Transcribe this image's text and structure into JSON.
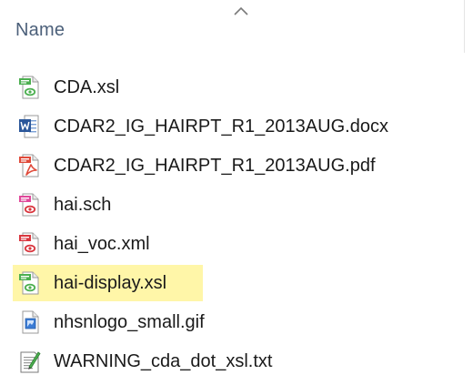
{
  "header": {
    "column_name": "Name",
    "sort_indicator_icon": "chevron-up-icon"
  },
  "files": [
    {
      "name": "CDA.xsl",
      "icon": "xsl-file-icon",
      "selected": false
    },
    {
      "name": "CDAR2_IG_HAIRPT_R1_2013AUG.docx",
      "icon": "word-document-icon",
      "selected": false
    },
    {
      "name": "CDAR2_IG_HAIRPT_R1_2013AUG.pdf",
      "icon": "pdf-file-icon",
      "selected": false
    },
    {
      "name": "hai.sch",
      "icon": "sch-file-icon",
      "selected": false
    },
    {
      "name": "hai_voc.xml",
      "icon": "xml-file-icon",
      "selected": false
    },
    {
      "name": "hai-display.xsl",
      "icon": "xsl-file-icon",
      "selected": true
    },
    {
      "name": "nhsnlogo_small.gif",
      "icon": "image-file-icon",
      "selected": false
    },
    {
      "name": "WARNING_cda_dot_xsl.txt",
      "icon": "text-file-icon",
      "selected": false
    }
  ],
  "colors": {
    "header_text": "#4c607a",
    "selection_highlight": "#fff6a8",
    "xsl_badge": "#4caf50",
    "word_blue": "#2b579a",
    "pdf_red": "#e04a3a",
    "sch_pink": "#e0489a",
    "xml_red": "#d9363e"
  }
}
